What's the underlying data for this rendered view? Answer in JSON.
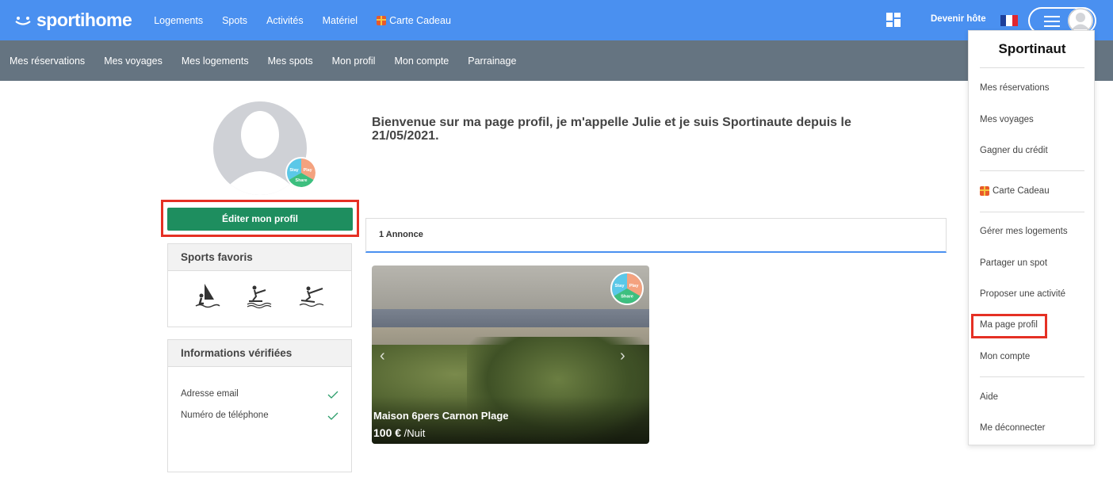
{
  "brand": {
    "name": "sportihome"
  },
  "topnav": {
    "items": [
      "Logements",
      "Spots",
      "Activités",
      "Matériel"
    ],
    "gift_label": "Carte Cadeau",
    "host_label": "Devenir hôte"
  },
  "subnav": [
    "Mes réservations",
    "Mes voyages",
    "Mes logements",
    "Mes spots",
    "Mon profil",
    "Mon compte",
    "Parrainage"
  ],
  "badge": {
    "stay": "Stay",
    "play": "Play",
    "share": "Share"
  },
  "profile": {
    "edit_label": "Éditer mon profil",
    "welcome": "Bienvenue sur ma page profil, je m'appelle Julie et je suis Sportinaute depuis le 21/05/2021."
  },
  "sports_card": {
    "title": "Sports favoris",
    "sports": [
      "windsurf-icon",
      "wakeboard-icon",
      "kitesurf-icon"
    ]
  },
  "verified_card": {
    "title": "Informations vérifiées",
    "items": [
      "Adresse email",
      "Numéro de téléphone"
    ]
  },
  "tabs": {
    "active": "1 Annonce"
  },
  "listing": {
    "title": "Maison 6pers Carnon Plage",
    "price": "100 €",
    "unit": "/Nuit"
  },
  "dropdown": {
    "title": "Sportinaut",
    "items": [
      "Mes réservations",
      "Mes voyages",
      "Gagner du crédit",
      "Carte Cadeau",
      "Gérer mes logements",
      "Partager un spot",
      "Proposer une activité",
      "Ma page profil",
      "Mon compte",
      "Aide",
      "Me déconnecter"
    ]
  },
  "colors": {
    "topbar": "#4a90f0",
    "subbar": "#657481",
    "edit_button": "#1e8e5f",
    "highlight": "#e53024"
  }
}
